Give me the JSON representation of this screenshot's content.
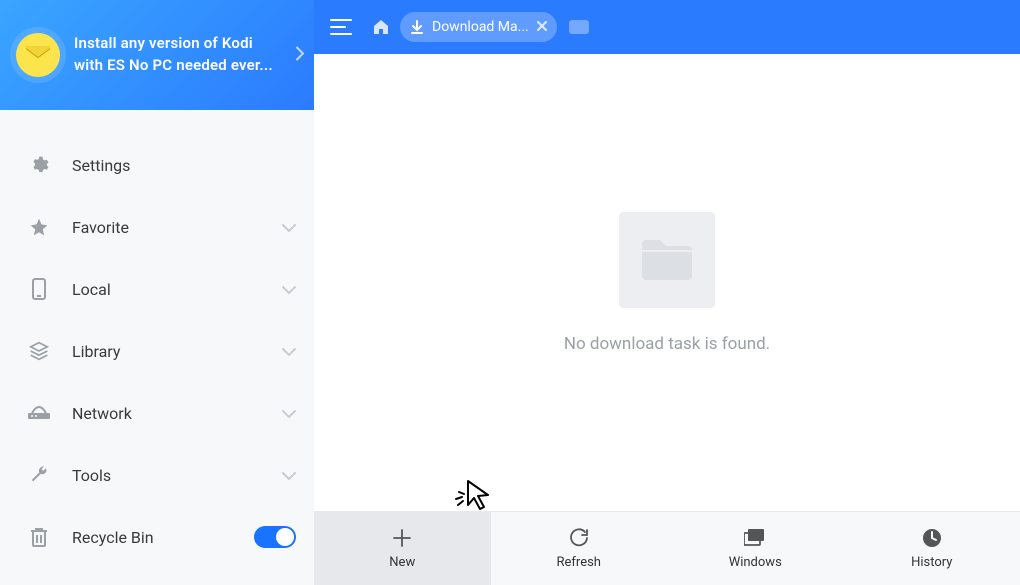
{
  "promo": {
    "line1": "Install any version of Kodi",
    "line2": "with ES No PC needed ever..."
  },
  "sidebar": {
    "settings": "Settings",
    "favorite": "Favorite",
    "local": "Local",
    "library": "Library",
    "network": "Network",
    "tools": "Tools",
    "recycle": "Recycle Bin"
  },
  "topbar": {
    "tab_label": "Download Ma..."
  },
  "empty_message": "No download task is found.",
  "bottom": {
    "new": "New",
    "refresh": "Refresh",
    "windows": "Windows",
    "history": "History"
  }
}
